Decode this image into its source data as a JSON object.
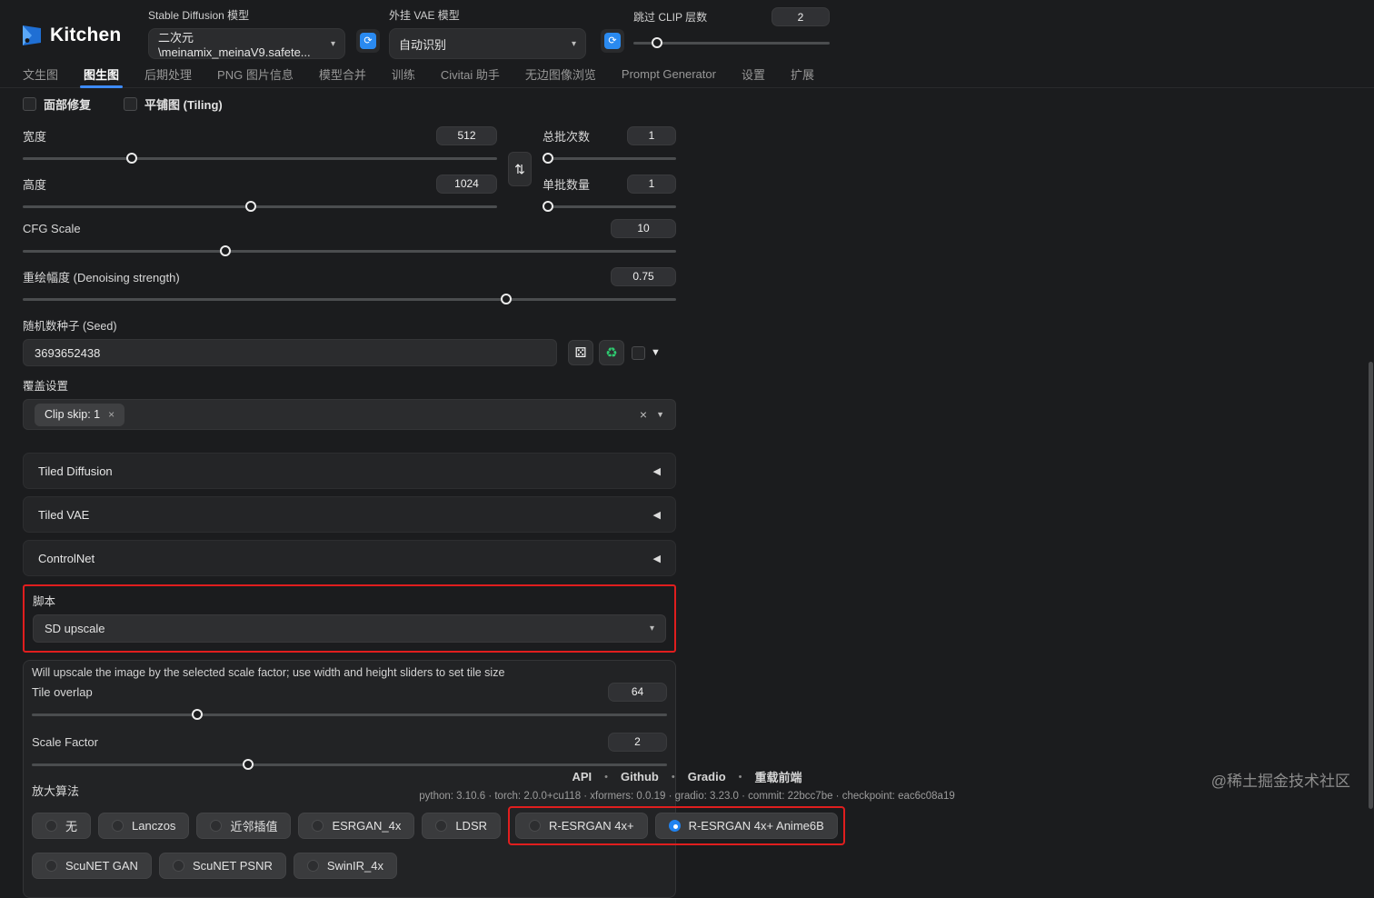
{
  "header": {
    "logo_text": "Kitchen",
    "sd_model": {
      "label": "Stable Diffusion 模型",
      "value": "二次元\\meinamix_meinaV9.safete..."
    },
    "vae": {
      "label": "外挂 VAE 模型",
      "value": "自动识别"
    },
    "clip_skip": {
      "label": "跳过 CLIP 层数",
      "value": "2",
      "percent": 12
    }
  },
  "tabs": [
    {
      "label": "文生图",
      "active": false
    },
    {
      "label": "图生图",
      "active": true
    },
    {
      "label": "后期处理",
      "active": false
    },
    {
      "label": "PNG 图片信息",
      "active": false
    },
    {
      "label": "模型合并",
      "active": false
    },
    {
      "label": "训练",
      "active": false
    },
    {
      "label": "Civitai 助手",
      "active": false
    },
    {
      "label": "无边图像浏览",
      "active": false
    },
    {
      "label": "Prompt Generator",
      "active": false
    },
    {
      "label": "设置",
      "active": false
    },
    {
      "label": "扩展",
      "active": false
    }
  ],
  "options": {
    "face_restore_label": "面部修复",
    "tiling_label": "平铺图 (Tiling)"
  },
  "sliders": {
    "width": {
      "label": "宽度",
      "value": "512",
      "percent": 23
    },
    "height": {
      "label": "高度",
      "value": "1024",
      "percent": 48
    },
    "batch_count": {
      "label": "总批次数",
      "value": "1",
      "percent": 4
    },
    "batch_size": {
      "label": "单批数量",
      "value": "1",
      "percent": 4
    },
    "cfg": {
      "label": "CFG Scale",
      "value": "10",
      "percent": 31
    },
    "denoising": {
      "label": "重绘幅度 (Denoising strength)",
      "value": "0.75",
      "percent": 74
    }
  },
  "seed": {
    "label": "随机数种子 (Seed)",
    "value": "3693652438"
  },
  "override": {
    "label": "覆盖设置",
    "chip": "Clip skip: 1"
  },
  "accordions": [
    {
      "label": "Tiled Diffusion"
    },
    {
      "label": "Tiled VAE"
    },
    {
      "label": "ControlNet"
    }
  ],
  "script": {
    "label": "脚本",
    "value": "SD upscale"
  },
  "upscale": {
    "info": "Will upscale the image by the selected scale factor; use width and height sliders to set tile size",
    "tile_overlap": {
      "label": "Tile overlap",
      "value": "64",
      "percent": 26
    },
    "scale_factor": {
      "label": "Scale Factor",
      "value": "2",
      "percent": 34
    },
    "upscaler_label": "放大算法",
    "upscalers": [
      {
        "label": "无",
        "selected": false,
        "red_box": false
      },
      {
        "label": "Lanczos",
        "selected": false,
        "red_box": false
      },
      {
        "label": "近邻插值",
        "selected": false,
        "red_box": false
      },
      {
        "label": "ESRGAN_4x",
        "selected": false,
        "red_box": false
      },
      {
        "label": "LDSR",
        "selected": false,
        "red_box": false
      },
      {
        "label": "R-ESRGAN 4x+",
        "selected": false,
        "red_box": true
      },
      {
        "label": "R-ESRGAN 4x+ Anime6B",
        "selected": true,
        "red_box": true
      },
      {
        "label": "ScuNET GAN",
        "selected": false,
        "red_box": false
      },
      {
        "label": "ScuNET PSNR",
        "selected": false,
        "red_box": false
      },
      {
        "label": "SwinIR_4x",
        "selected": false,
        "red_box": false
      }
    ]
  },
  "footer": {
    "links": [
      "API",
      "Github",
      "Gradio",
      "重载前端"
    ],
    "versions": "python: 3.10.6   ·   torch: 2.0.0+cu118   ·   xformers: 0.0.19   ·   gradio: 3.23.0   ·   commit: 22bcc7be   ·   checkpoint: eac6c08a19"
  },
  "watermark": "@稀土掘金技术社区",
  "colors": {
    "accent_blue": "#2e8bf0",
    "highlight_red": "#e01e1e",
    "radio_selected": "#2083f0",
    "recycle_green": "#2ecc71"
  }
}
